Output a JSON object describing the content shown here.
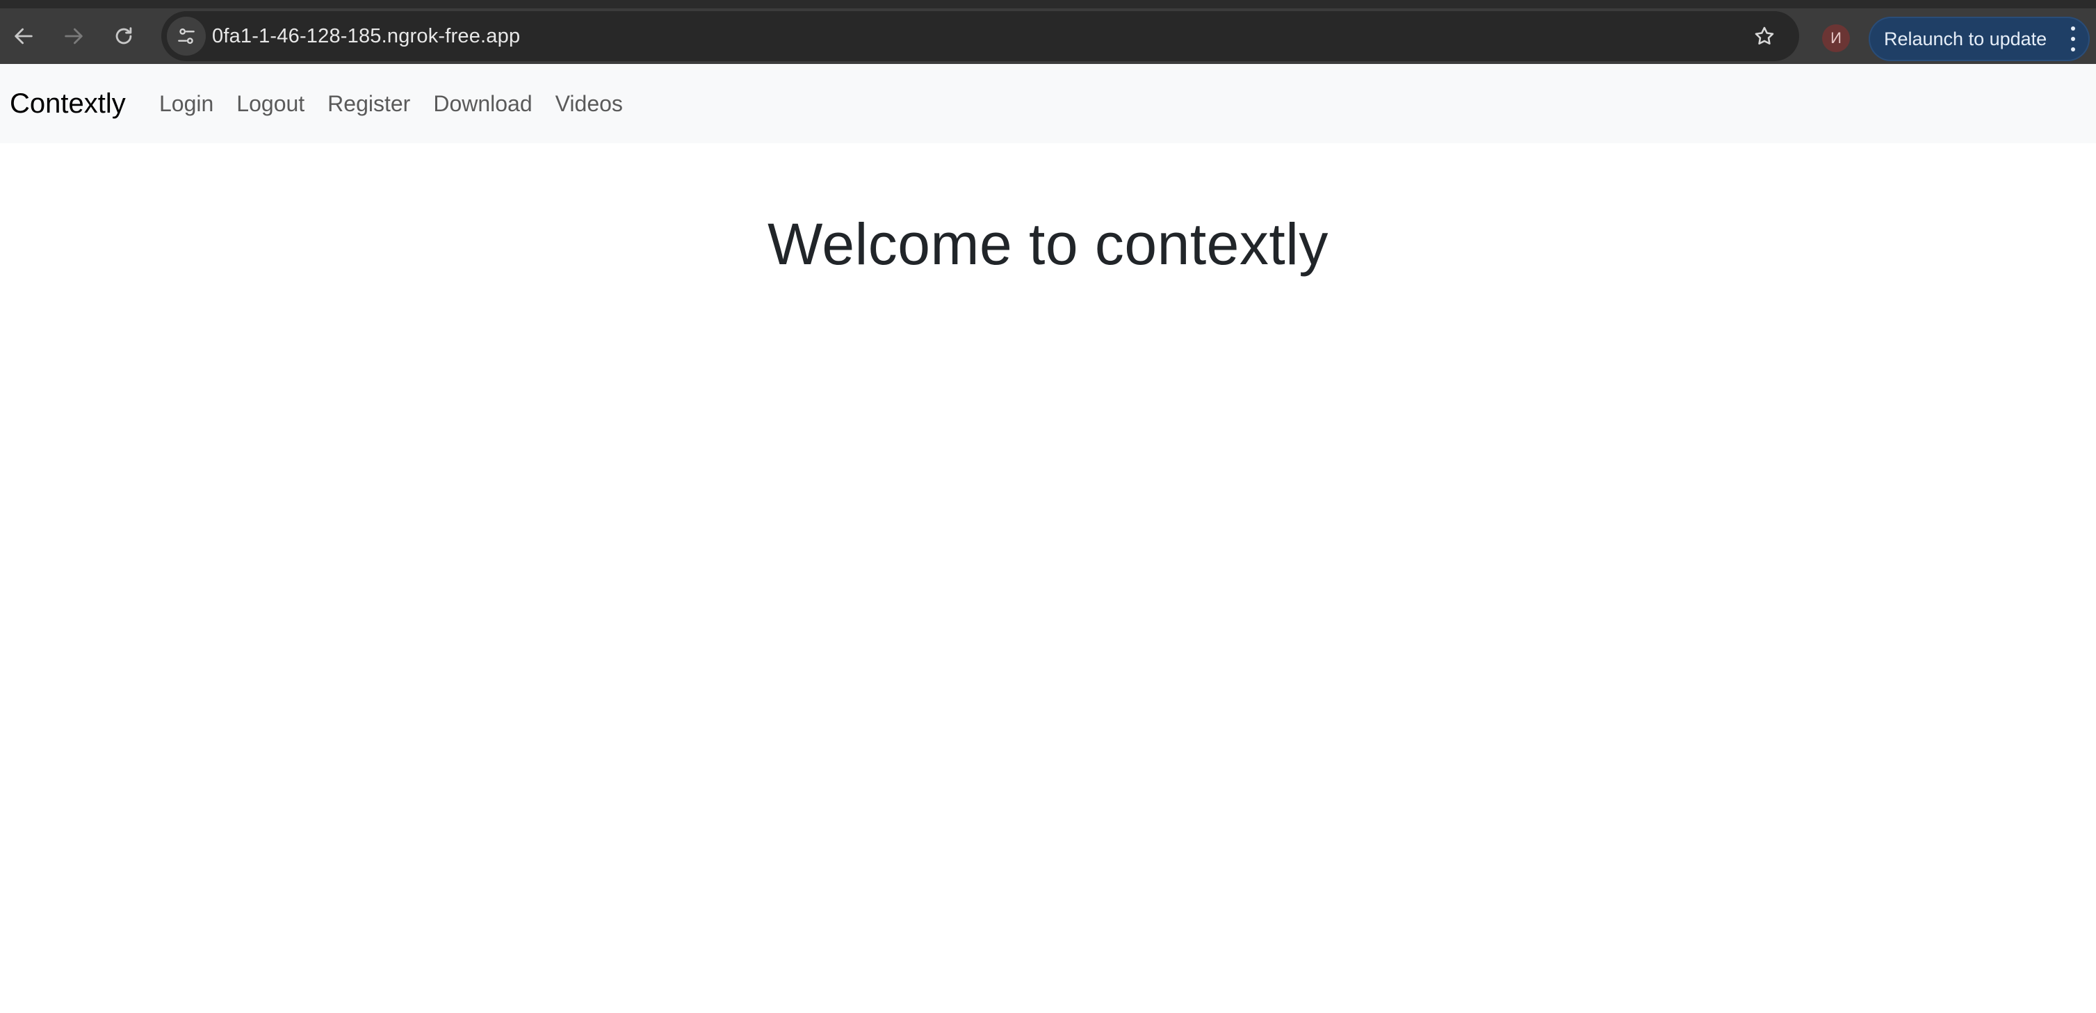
{
  "browser": {
    "url": "0fa1-1-46-128-185.ngrok-free.app",
    "avatar_initial": "И",
    "relaunch_label": "Relaunch to update",
    "icons": {
      "back": "back-arrow-icon",
      "forward": "forward-arrow-icon",
      "reload": "reload-icon",
      "site_info": "tune-icon",
      "bookmark": "star-icon",
      "menu": "kebab-menu-icon"
    },
    "colors": {
      "chrome_bg": "#3c3c3c",
      "omnibox_bg": "#282828",
      "relaunch_bg": "#1f3f66",
      "avatar_bg": "#6b3534"
    }
  },
  "navbar": {
    "brand": "Contextly",
    "links": [
      {
        "label": "Login"
      },
      {
        "label": "Logout"
      },
      {
        "label": "Register"
      },
      {
        "label": "Download"
      },
      {
        "label": "Videos"
      }
    ],
    "colors": {
      "background": "#f8f9fa",
      "link": "#5a5a5a"
    }
  },
  "main": {
    "heading": "Welcome to contextly"
  }
}
